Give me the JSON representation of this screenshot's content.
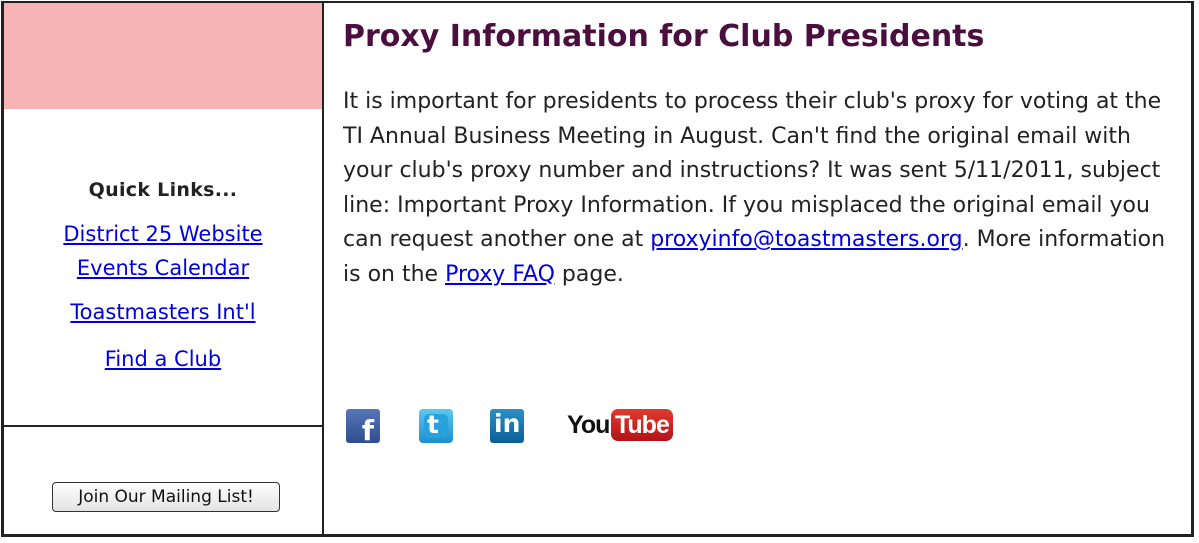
{
  "sidebar": {
    "band_color": "#f5b3b3",
    "quick_links_heading": "Quick Links...",
    "links": [
      {
        "label": "District 25 Website"
      },
      {
        "label": "Events Calendar"
      },
      {
        "label": "Toastmasters Int'l "
      },
      {
        "label": "Find a Club"
      }
    ],
    "join_button_label": "Join Our Mailing List!"
  },
  "main": {
    "title": "Proxy Information for Club Presidents",
    "title_color": "#4b0f3f",
    "paragraph": {
      "text_1": "It is important for presidents to process their club's proxy for voting at the TI Annual Business Meeting in August. Can't find the original email with your club's proxy number and instructions? It was sent 5/11/2011, subject line:  Important Proxy Information. If you misplaced the original email you can request another one at ",
      "email_link": "proxyinfo@toastmasters.org",
      "text_2": ". More information is on the ",
      "faq_link": "Proxy FAQ",
      "text_3": " page."
    },
    "social": [
      {
        "icon": "facebook-icon",
        "glyph": "f"
      },
      {
        "icon": "twitter-icon",
        "glyph": "t"
      },
      {
        "icon": "linkedin-icon",
        "glyph": "in"
      },
      {
        "icon": "youtube-icon",
        "glyph_you": "You",
        "glyph_tube": "Tube"
      }
    ]
  },
  "colors": {
    "link": "#0000dd",
    "border": "#222222"
  }
}
